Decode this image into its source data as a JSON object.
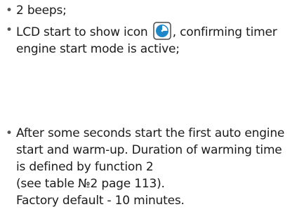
{
  "bullet": "•",
  "items": [
    {
      "text": "2 beeps;"
    },
    {
      "line1_before": "LCD start to show icon",
      "icon": "timer-engine-icon",
      "line1_after": ", confirming timer",
      "line2": "engine start mode is active;"
    },
    {
      "lines": [
        "After some seconds start the first auto engine",
        "start and warm-up. Duration of warming time",
        "is defined by function 2",
        "(see table №2 page 113).",
        "Factory default - 10 minutes."
      ]
    }
  ],
  "colors": {
    "icon_fill": "#1f86c8",
    "icon_border": "#4a4a4a",
    "icon_bg": "#ffffff"
  }
}
